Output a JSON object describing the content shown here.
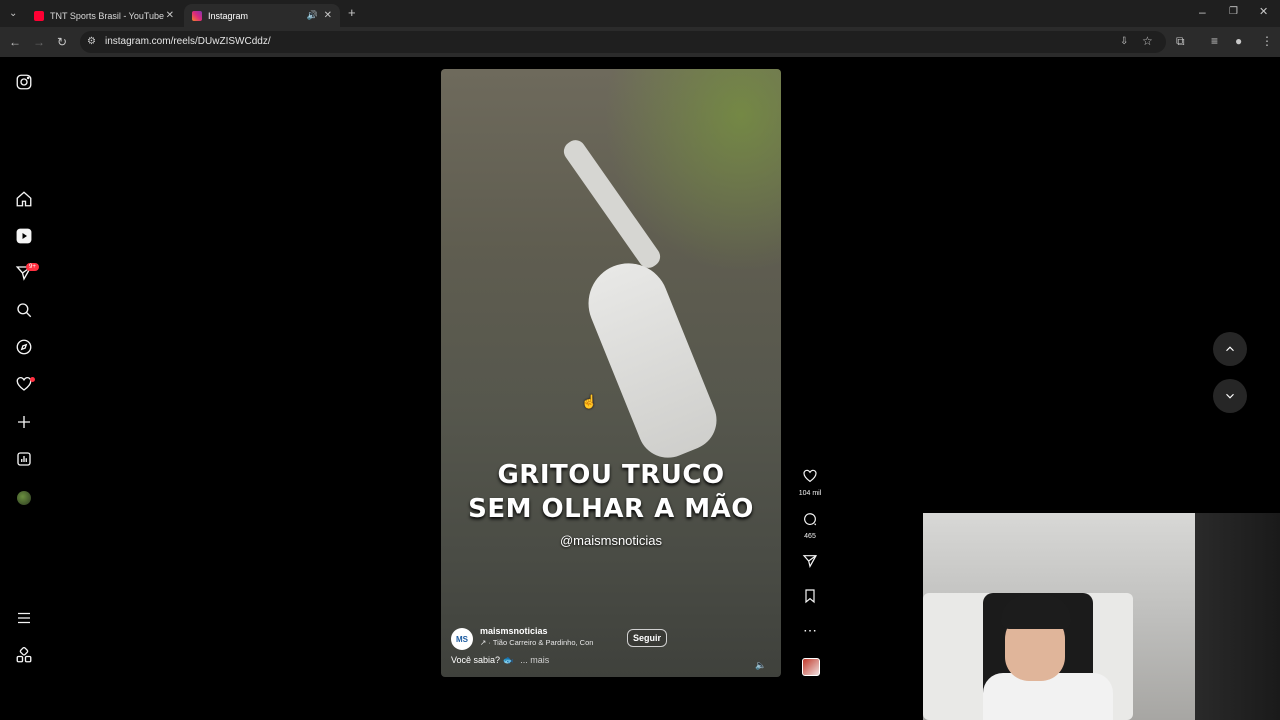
{
  "browser": {
    "tabs": [
      {
        "title": "TNT Sports Brasil - YouTube",
        "favicon_color": "#ff0033"
      },
      {
        "title": "Instagram",
        "favicon_color": "#e1306c",
        "active": true
      }
    ],
    "url": "instagram.com/reels/DUwZISWCddz/"
  },
  "sidebar": {
    "notification_badge": "9+",
    "items": [
      "instagram-logo",
      "home",
      "reels",
      "messages",
      "search",
      "explore",
      "notifications",
      "create",
      "dashboard",
      "profile",
      "more",
      "also-from-meta"
    ]
  },
  "reel": {
    "caption_lines": [
      "GRITOU TRUCO",
      "SEM OLHAR A MÃO"
    ],
    "watermark_handle": "@maismsnoticias",
    "author": {
      "avatar_text": "MS",
      "username": "maismsnoticias",
      "audio": "Tião Carreiro & Pardinho, Con",
      "follow_label": "Seguir"
    },
    "description": "Você sabia? 🐟",
    "more_label": "... mais",
    "actions": {
      "likes": "104 mil",
      "comments": "465"
    }
  },
  "colors": {
    "accent_red": "#ff3040",
    "background": "#000000",
    "nav_button_bg": "#262626"
  }
}
